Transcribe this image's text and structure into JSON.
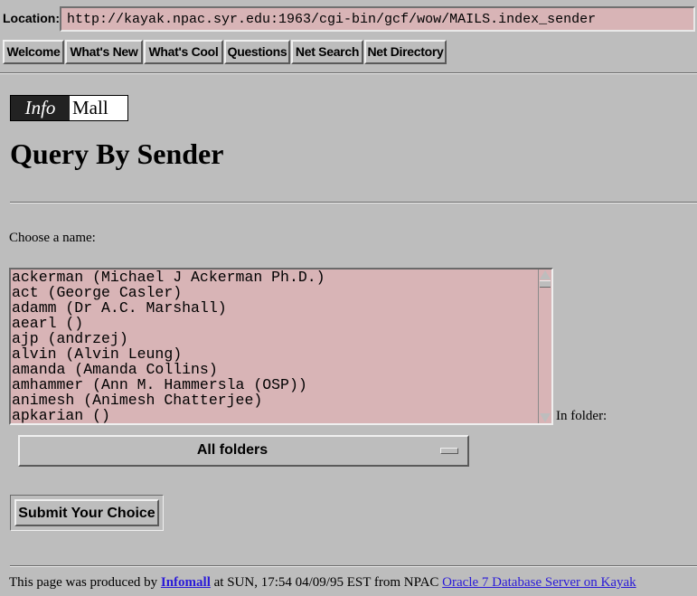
{
  "location": {
    "label": "Location:",
    "url": "http://kayak.npac.syr.edu:1963/cgi-bin/gcf/wow/MAILS.index_sender"
  },
  "directory_buttons": [
    {
      "label": "Welcome"
    },
    {
      "label": "What's New"
    },
    {
      "label": "What's Cool"
    },
    {
      "label": "Questions"
    },
    {
      "label": "Net Search"
    },
    {
      "label": "Net Directory"
    }
  ],
  "logo": {
    "info": "Info",
    "mall": "Mall"
  },
  "page_title": "Query By Sender",
  "choose_label": "Choose a name:",
  "senders": [
    "ackerman (Michael J Ackerman Ph.D.)",
    "act (George Casler)",
    "adamm (Dr A.C. Marshall)",
    "aearl ()",
    "ajp (andrzej)",
    "alvin (Alvin Leung)",
    "amanda (Amanda Collins)",
    "amhammer (Ann M. Hammersla (OSP))",
    "animesh (Animesh Chatterjee)",
    "apkarian ()"
  ],
  "folder": {
    "label": "In folder:",
    "selected": "All folders"
  },
  "submit_label": "Submit Your Choice",
  "footer": {
    "prefix": "This page was produced by ",
    "infomall_link": "Infomall",
    "middle": " at SUN, 17:54 04/09/95 EST from NPAC ",
    "server_link": "Oracle 7 Database Server on Kayak"
  }
}
